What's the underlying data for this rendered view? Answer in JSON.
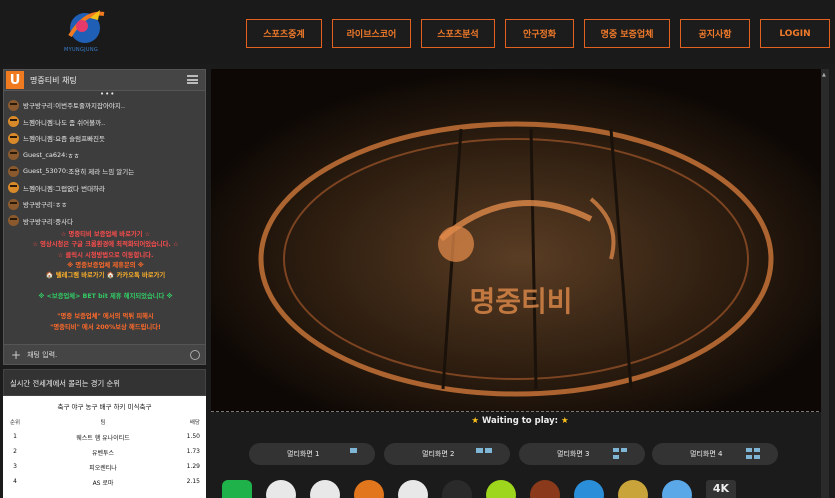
{
  "header": {
    "logo_text": "MYUNGJUNG",
    "nav": [
      {
        "label": "스포츠중계",
        "name": "nav-sports-broadcast",
        "w": 76
      },
      {
        "label": "라이브스코어",
        "name": "nav-livescore",
        "w": 79
      },
      {
        "label": "스포츠분석",
        "name": "nav-sports-analysis",
        "w": 74
      },
      {
        "label": "안구정화",
        "name": "nav-eye-candy",
        "w": 69
      },
      {
        "label": "명중 보증업체",
        "name": "nav-verified-sites",
        "w": 86
      },
      {
        "label": "공지사항",
        "name": "nav-notice",
        "w": 70
      },
      {
        "label": "LOGIN",
        "name": "nav-login",
        "w": 70
      }
    ]
  },
  "chat": {
    "title": "명중티비 채팅",
    "logo_letter": "U",
    "messages": [
      {
        "user": "방구방구리",
        "text": "이번주토줄까지잡아야지.."
      },
      {
        "user": "느껨아니껨",
        "text": "나도 좀 쉬어볼까.."
      },
      {
        "user": "느껨아니껨",
        "text": "요즘 슬럼프빠진듯"
      },
      {
        "user": "Guest_ca624",
        "text": "ㅎㅎ"
      },
      {
        "user": "Guest_53070",
        "text": "조용히 제라 느낌 알기는"
      },
      {
        "user": "느껨아니껨",
        "text": "그럽없다 번대하라"
      },
      {
        "user": "방구방구리",
        "text": "ㅎㅎ"
      },
      {
        "user": "방구방구리",
        "text": "중사다"
      }
    ],
    "notices": [
      {
        "text": "☆ 명중티비 보증업체 바로가기 ☆",
        "color": "#ff4d4d"
      },
      {
        "text": "☆ 영상시청은 구글 크롬환경에 최적화되어있습니다. ☆",
        "color": "#ff4d4d"
      },
      {
        "text": "☆ 클릭시 시청방법으로 이동합니다.",
        "color": "#ff4d4d"
      },
      {
        "text": "※ 명중보증업체 제휴문의 ※",
        "color": "#ff6a2a"
      },
      {
        "text": "🏠 텔레그램 바로가기 🏠 카카오톡 바로가기",
        "color": "#ffb12a"
      },
      {
        "text": "",
        "color": "#fff"
      },
      {
        "text": "※ <보증업체> BET bit 제휴 해지되었습니다 ※",
        "color": "#33cc66"
      },
      {
        "text": "",
        "color": "#fff"
      },
      {
        "text": "\"명중 보증업체\" 에서의 먹튀 피해시",
        "color": "#ff6a2a"
      },
      {
        "text": "\"명중티비\" 에서 200%보상 해드립니다!",
        "color": "#ff6a2a"
      }
    ],
    "input_placeholder": "채팅 입력."
  },
  "ranking": {
    "title": "실시간 전세계에서 몰리는 경기 순위",
    "categories": "축구 야구 농구 배구 하키 미식축구",
    "columns": [
      "순위",
      "팀",
      "배당"
    ],
    "rows": [
      {
        "rank": "1",
        "team": "웨스트 햄 유나이티드",
        "odds": "1.50"
      },
      {
        "rank": "2",
        "team": "유벤투스",
        "odds": "1.73"
      },
      {
        "rank": "3",
        "team": "피오렌티나",
        "odds": "1.29"
      },
      {
        "rank": "4",
        "team": "AS 로마",
        "odds": "2.15"
      }
    ]
  },
  "player": {
    "waiting_text": "Waiting to play:",
    "watermark_text": "명중티비",
    "multi": [
      {
        "label": "멀티화면 1",
        "name": "multi-screen-1-button"
      },
      {
        "label": "멀티화면 2",
        "name": "multi-screen-2-button"
      },
      {
        "label": "멀티화면 3",
        "name": "multi-screen-3-button"
      },
      {
        "label": "멀티화면 4",
        "name": "multi-screen-4-button"
      }
    ]
  },
  "sports_icons": [
    {
      "name": "app-icon",
      "color": "#1fb24a"
    },
    {
      "name": "soccer-ball-icon",
      "color": "#e8e8e8"
    },
    {
      "name": "baseball-icon",
      "color": "#e8e8e8"
    },
    {
      "name": "basketball-icon",
      "color": "#e2761c"
    },
    {
      "name": "volleyball-icon",
      "color": "#e8e8e8"
    },
    {
      "name": "hockey-puck-icon",
      "color": "#2a2a2a"
    },
    {
      "name": "tennis-ball-icon",
      "color": "#9ed51d"
    },
    {
      "name": "football-icon",
      "color": "#8a3a1a"
    },
    {
      "name": "browser-icon",
      "color": "#2a8fd8"
    },
    {
      "name": "league-icon",
      "color": "#c9a43a"
    },
    {
      "name": "cloud-icon",
      "color": "#5aa8e8"
    },
    {
      "name": "4k-icon",
      "color": "#333333"
    }
  ],
  "four_k_label": "4K"
}
